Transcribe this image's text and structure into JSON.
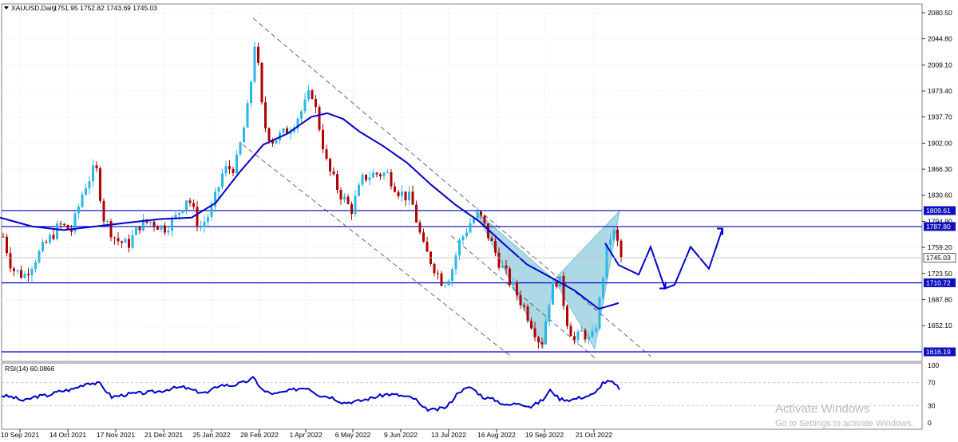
{
  "chart_data": {
    "type": "candlestick",
    "title": "XAUUSD,Daily",
    "ohlc": "1751.95 1752.82 1743.69 1745.03",
    "price_axis": {
      "min": 1616.19,
      "max": 2080.5,
      "ticks": [
        "2080.50",
        "2044.80",
        "2009.10",
        "1973.40",
        "1937.70",
        "1902.00",
        "1866.30",
        "1830.60",
        "1794.90",
        "1759.20",
        "1723.50",
        "1687.80",
        "1652.10"
      ]
    },
    "time_axis": [
      "10 Sep 2021",
      "14 Oct 2021",
      "17 Nov 2021",
      "21 Dec 2021",
      "25 Jan 2022",
      "28 Feb 2022",
      "1 Apr 2022",
      "6 May 2022",
      "9 Jun 2022",
      "13 Jul 2022",
      "16 Aug 2022",
      "19 Sep 2022",
      "21 Oct 2022"
    ],
    "time_positions": [
      25,
      85,
      145,
      205,
      265,
      325,
      383,
      442,
      502,
      562,
      622,
      682,
      744
    ],
    "current_price": "1745.03",
    "levels": [
      {
        "value": 1809.61,
        "label": "1809.61"
      },
      {
        "value": 1787.8,
        "label": "1787.80"
      },
      {
        "value": 1710.72,
        "label": "1710.72"
      },
      {
        "value": 1616.19,
        "label": "1616.19"
      }
    ],
    "moving_average_path": [
      [
        0,
        1800
      ],
      [
        40,
        1788
      ],
      [
        80,
        1783
      ],
      [
        120,
        1788
      ],
      [
        160,
        1793
      ],
      [
        200,
        1798
      ],
      [
        240,
        1800
      ],
      [
        270,
        1820
      ],
      [
        300,
        1862
      ],
      [
        330,
        1900
      ],
      [
        360,
        1915
      ],
      [
        390,
        1938
      ],
      [
        410,
        1943
      ],
      [
        430,
        1935
      ],
      [
        450,
        1918
      ],
      [
        480,
        1898
      ],
      [
        510,
        1875
      ],
      [
        540,
        1845
      ],
      [
        570,
        1818
      ],
      [
        600,
        1795
      ],
      [
        630,
        1765
      ],
      [
        660,
        1736
      ],
      [
        690,
        1718
      ],
      [
        720,
        1700
      ],
      [
        750,
        1675
      ],
      [
        775,
        1683
      ]
    ],
    "price_path": [
      [
        0,
        1790
      ],
      [
        15,
        1730
      ],
      [
        30,
        1720
      ],
      [
        45,
        1745
      ],
      [
        60,
        1768
      ],
      [
        75,
        1790
      ],
      [
        90,
        1782
      ],
      [
        105,
        1840
      ],
      [
        120,
        1870
      ],
      [
        130,
        1800
      ],
      [
        145,
        1770
      ],
      [
        160,
        1762
      ],
      [
        175,
        1790
      ],
      [
        190,
        1795
      ],
      [
        205,
        1785
      ],
      [
        220,
        1800
      ],
      [
        235,
        1830
      ],
      [
        250,
        1785
      ],
      [
        265,
        1810
      ],
      [
        280,
        1865
      ],
      [
        295,
        1870
      ],
      [
        305,
        1920
      ],
      [
        312,
        1960
      ],
      [
        320,
        2050
      ],
      [
        325,
        1985
      ],
      [
        330,
        1930
      ],
      [
        340,
        1905
      ],
      [
        355,
        1915
      ],
      [
        365,
        1925
      ],
      [
        380,
        1950
      ],
      [
        390,
        1975
      ],
      [
        398,
        1935
      ],
      [
        410,
        1870
      ],
      [
        425,
        1835
      ],
      [
        440,
        1810
      ],
      [
        455,
        1855
      ],
      [
        470,
        1860
      ],
      [
        485,
        1860
      ],
      [
        500,
        1835
      ],
      [
        515,
        1825
      ],
      [
        530,
        1760
      ],
      [
        545,
        1730
      ],
      [
        555,
        1710
      ],
      [
        565,
        1725
      ],
      [
        575,
        1765
      ],
      [
        590,
        1795
      ],
      [
        600,
        1805
      ],
      [
        610,
        1780
      ],
      [
        625,
        1740
      ],
      [
        640,
        1710
      ],
      [
        655,
        1680
      ],
      [
        668,
        1650
      ],
      [
        678,
        1625
      ],
      [
        690,
        1700
      ],
      [
        700,
        1720
      ],
      [
        710,
        1660
      ],
      [
        720,
        1630
      ],
      [
        730,
        1645
      ],
      [
        740,
        1628
      ],
      [
        748,
        1660
      ],
      [
        755,
        1718
      ],
      [
        762,
        1770
      ],
      [
        770,
        1780
      ],
      [
        778,
        1745
      ]
    ],
    "harmonic_pattern": [
      [
        596,
        1809
      ],
      [
        680,
        1622
      ],
      [
        694,
        1715
      ],
      [
        745,
        1620
      ],
      [
        776,
        1809
      ]
    ],
    "channel_lines": [
      [
        [
          317,
          2073
        ],
        [
          815,
          1610
        ]
      ],
      [
        [
          304,
          1900
        ],
        [
          640,
          1610
        ]
      ],
      [
        [
          565,
          1775
        ],
        [
          745,
          1608
        ]
      ]
    ],
    "projection_path": [
      [
        758,
        1765
      ],
      [
        775,
        1735
      ],
      [
        800,
        1722
      ],
      [
        815,
        1760
      ],
      [
        833,
        1703
      ],
      [
        845,
        1708
      ],
      [
        865,
        1760
      ],
      [
        888,
        1730
      ],
      [
        905,
        1785
      ]
    ],
    "rsi": {
      "label": "RSI(14) 60.0866",
      "min": 0,
      "max": 100,
      "ticks": [
        "100",
        "70",
        "30",
        "0"
      ],
      "values": [
        [
          0,
          48
        ],
        [
          15,
          45
        ],
        [
          30,
          38
        ],
        [
          45,
          46
        ],
        [
          60,
          48
        ],
        [
          75,
          55
        ],
        [
          90,
          58
        ],
        [
          110,
          70
        ],
        [
          125,
          68
        ],
        [
          140,
          45
        ],
        [
          160,
          50
        ],
        [
          180,
          52
        ],
        [
          200,
          55
        ],
        [
          215,
          60
        ],
        [
          230,
          62
        ],
        [
          245,
          55
        ],
        [
          260,
          52
        ],
        [
          275,
          66
        ],
        [
          290,
          65
        ],
        [
          305,
          70
        ],
        [
          318,
          78
        ],
        [
          330,
          55
        ],
        [
          345,
          50
        ],
        [
          360,
          55
        ],
        [
          375,
          60
        ],
        [
          385,
          62
        ],
        [
          400,
          48
        ],
        [
          415,
          45
        ],
        [
          430,
          35
        ],
        [
          450,
          38
        ],
        [
          470,
          45
        ],
        [
          485,
          50
        ],
        [
          500,
          48
        ],
        [
          520,
          42
        ],
        [
          530,
          25
        ],
        [
          545,
          22
        ],
        [
          560,
          28
        ],
        [
          575,
          55
        ],
        [
          590,
          62
        ],
        [
          605,
          45
        ],
        [
          620,
          40
        ],
        [
          635,
          30
        ],
        [
          650,
          35
        ],
        [
          665,
          28
        ],
        [
          680,
          40
        ],
        [
          690,
          58
        ],
        [
          700,
          42
        ],
        [
          715,
          40
        ],
        [
          730,
          45
        ],
        [
          745,
          50
        ],
        [
          755,
          70
        ],
        [
          765,
          72
        ],
        [
          776,
          60
        ]
      ]
    }
  },
  "watermark": {
    "line1": "Activate Windows",
    "line2": "Go to Settings to activate Windows."
  },
  "colors": {
    "candle_up": "#29b6e8",
    "candle_down": "#b00000",
    "blue": "#0000cc",
    "pattern_fill": "#add8e6",
    "label_bg": "#1010c0",
    "grid": "#e8e8e8"
  }
}
